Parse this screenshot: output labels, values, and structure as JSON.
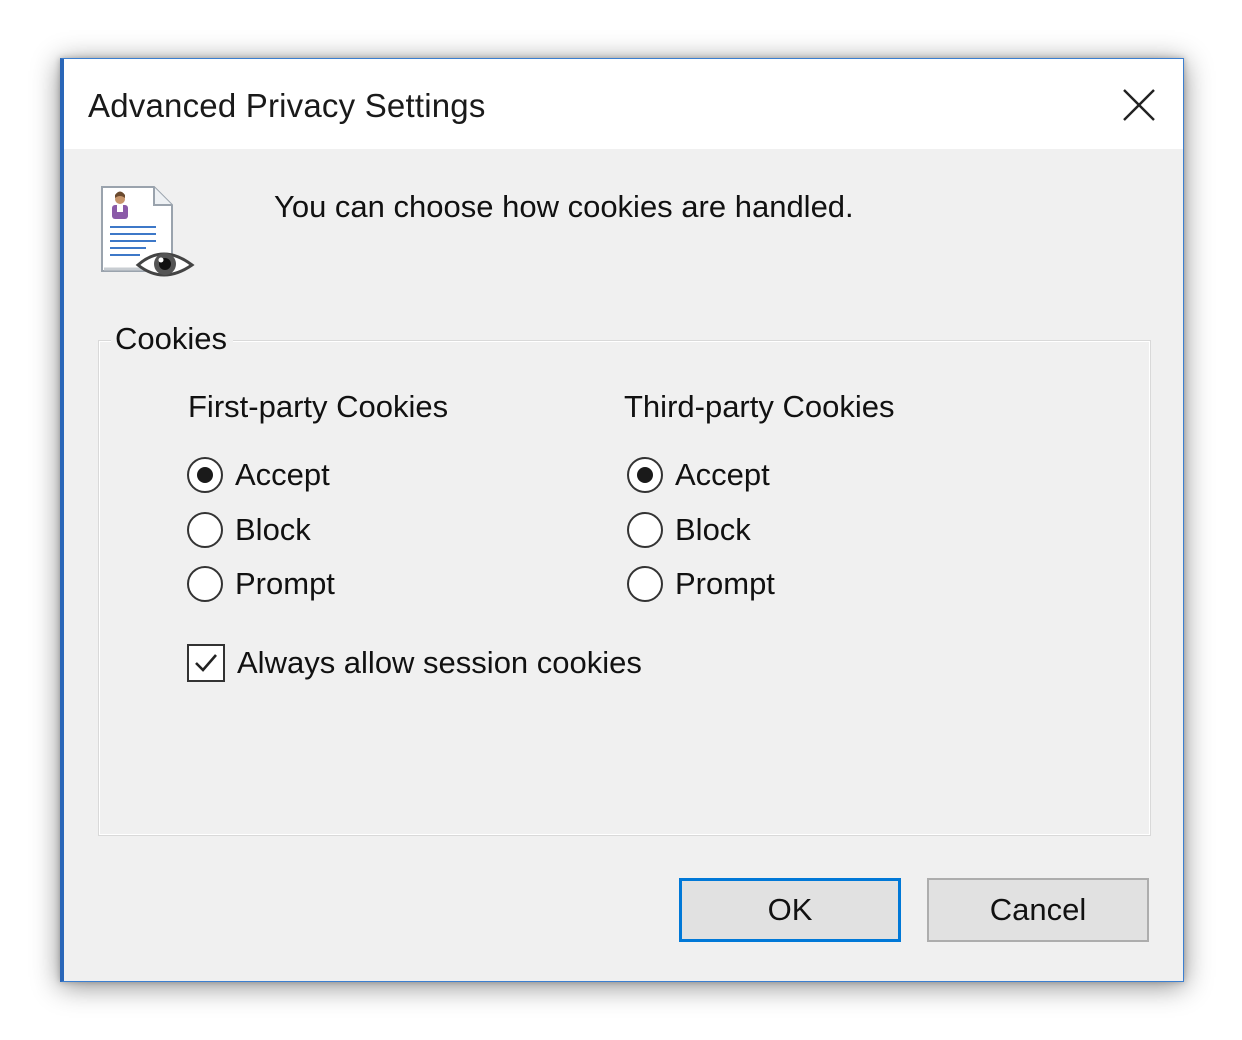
{
  "window": {
    "title": "Advanced Privacy Settings",
    "close_icon": "close-icon"
  },
  "intro": {
    "icon": "privacy-document-eye-icon",
    "text": "You can choose how cookies are handled."
  },
  "cookies_group": {
    "legend": "Cookies",
    "first_party": {
      "title": "First-party Cookies",
      "options": [
        {
          "label": "Accept",
          "checked": true
        },
        {
          "label": "Block",
          "checked": false
        },
        {
          "label": "Prompt",
          "checked": false
        }
      ]
    },
    "third_party": {
      "title": "Third-party Cookies",
      "options": [
        {
          "label": "Accept",
          "checked": true
        },
        {
          "label": "Block",
          "checked": false
        },
        {
          "label": "Prompt",
          "checked": false
        }
      ]
    },
    "session_cookies": {
      "label": "Always allow session cookies",
      "checked": true
    }
  },
  "buttons": {
    "ok_label": "OK",
    "cancel_label": "Cancel"
  },
  "colors": {
    "accent": "#0078d7",
    "window_border": "#3c7fd0",
    "dialog_bg": "#f0f0f0"
  }
}
